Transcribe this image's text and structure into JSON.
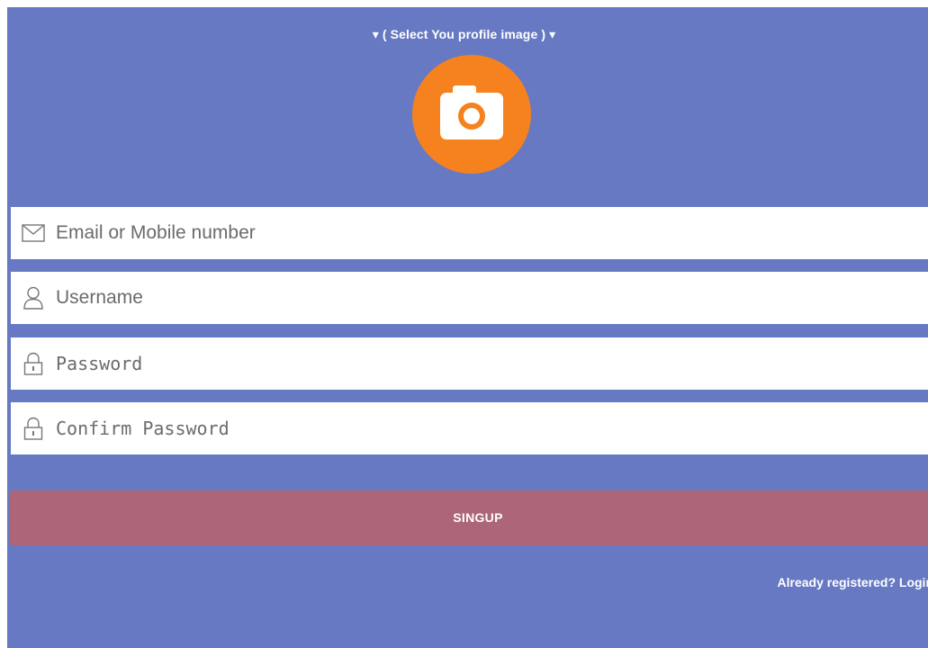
{
  "header": {
    "select_profile_image": "▾ ( Select You profile image ) ▾"
  },
  "avatar": {
    "icon": "camera-icon",
    "background_color": "#f6811f"
  },
  "form": {
    "email_placeholder": "Email or Mobile number",
    "username_placeholder": "Username",
    "password_placeholder": "Password",
    "confirm_password_placeholder": "Confirm Password",
    "icons": {
      "email": "mail-icon",
      "username": "user-icon",
      "password": "lock-icon",
      "confirm_password": "lock-icon"
    }
  },
  "actions": {
    "signup_label": "SINGUP",
    "login_link": "Already registered? Login"
  },
  "colors": {
    "background": "#6679c2",
    "button": "#ad6578",
    "accent": "#f6811f"
  }
}
